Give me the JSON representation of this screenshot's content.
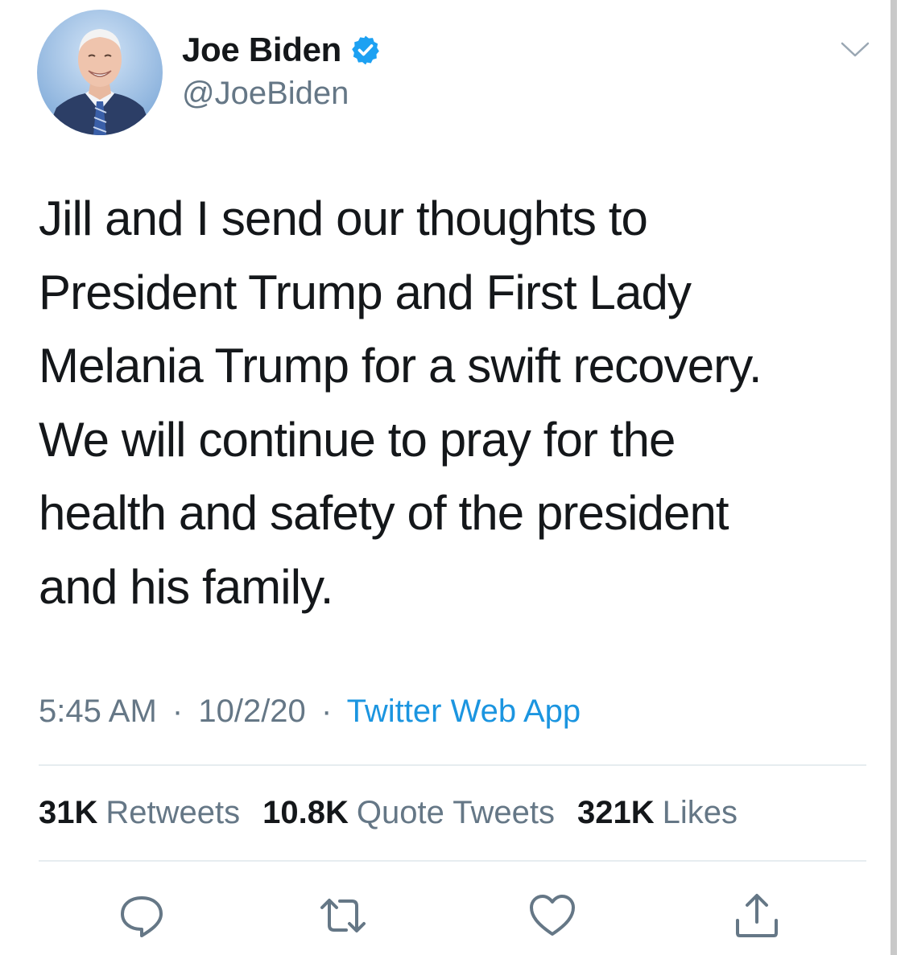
{
  "user": {
    "display_name": "Joe Biden",
    "handle": "@JoeBiden",
    "verified": true,
    "avatar_icon": "profile-photo"
  },
  "tweet": {
    "text": "Jill and I send our thoughts to\nPresident Trump and First Lady\nMelania Trump for a swift recovery.\nWe will continue to pray for the\nhealth and safety of the president\nand his family.",
    "time": "5:45 AM",
    "date": "10/2/20",
    "separator": "·",
    "source": "Twitter Web App"
  },
  "stats": [
    {
      "count": "31K",
      "label": "Retweets"
    },
    {
      "count": "10.8K",
      "label": "Quote Tweets"
    },
    {
      "count": "321K",
      "label": "Likes"
    }
  ],
  "actions": [
    {
      "icon": "reply-icon"
    },
    {
      "icon": "retweet-icon"
    },
    {
      "icon": "like-icon"
    },
    {
      "icon": "share-icon"
    }
  ],
  "colors": {
    "text": "#14171a",
    "secondary": "#657786",
    "link": "#1b95e0",
    "verified": "#1da1f2",
    "divider": "#e6ecf0"
  }
}
